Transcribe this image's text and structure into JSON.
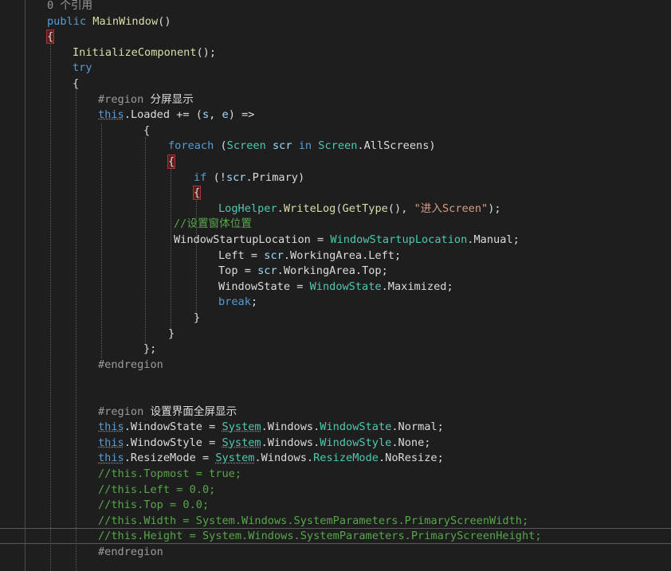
{
  "editor": {
    "codelens": "0 个引用",
    "lines": [
      [
        [
          "lens",
          "0 个引用"
        ]
      ],
      [
        [
          "kw",
          "public "
        ],
        [
          "method",
          "MainWindow"
        ],
        [
          "plain",
          "()"
        ]
      ],
      [
        [
          "hlbr",
          "{"
        ]
      ],
      [
        [
          "method",
          "InitializeComponent"
        ],
        [
          "plain",
          "();"
        ]
      ],
      [
        [
          "kw",
          "try"
        ]
      ],
      [
        [
          "plain",
          "{"
        ]
      ],
      [
        [
          "region",
          "#region "
        ],
        [
          "plain",
          "分屏显示"
        ]
      ],
      [
        [
          "kw",
          "this"
        ],
        [
          "plain",
          "."
        ],
        [
          "plain",
          "Loaded += ("
        ],
        [
          "param",
          "s"
        ],
        [
          "plain",
          ", "
        ],
        [
          "param",
          "e"
        ],
        [
          "plain",
          ") =>"
        ]
      ],
      [
        [
          "plain",
          "{"
        ]
      ],
      [
        [
          "kw",
          "foreach "
        ],
        [
          "plain",
          "("
        ],
        [
          "type",
          "Screen "
        ],
        [
          "param",
          "scr "
        ],
        [
          "kw",
          "in "
        ],
        [
          "type",
          "Screen"
        ],
        [
          "plain",
          ".AllScreens)"
        ]
      ],
      [
        [
          "hlbr",
          "{"
        ]
      ],
      [
        [
          "kw",
          "if "
        ],
        [
          "plain",
          "(!"
        ],
        [
          "param",
          "scr"
        ],
        [
          "plain",
          ".Primary)"
        ]
      ],
      [
        [
          "hlbr",
          "{"
        ]
      ],
      [
        [
          "type",
          "LogHelper"
        ],
        [
          "plain",
          "."
        ],
        [
          "method",
          "WriteLog"
        ],
        [
          "plain",
          "("
        ],
        [
          "method",
          "GetType"
        ],
        [
          "plain",
          "(), "
        ],
        [
          "str",
          "\"进入Screen\""
        ],
        [
          "plain",
          ");"
        ]
      ],
      [
        [
          "comment",
          "//设置窗体位置"
        ]
      ],
      [
        [
          "plain",
          "WindowStartupLocation = "
        ],
        [
          "type",
          "WindowStartupLocation"
        ],
        [
          "plain",
          ".Manual;"
        ]
      ],
      [
        [
          "plain",
          "Left = "
        ],
        [
          "param",
          "scr"
        ],
        [
          "plain",
          ".WorkingArea.Left;"
        ]
      ],
      [
        [
          "plain",
          "Top = "
        ],
        [
          "param",
          "scr"
        ],
        [
          "plain",
          ".WorkingArea.Top;"
        ]
      ],
      [
        [
          "plain",
          "WindowState = "
        ],
        [
          "type",
          "WindowState"
        ],
        [
          "plain",
          ".Maximized;"
        ]
      ],
      [
        [
          "kw",
          "break"
        ],
        [
          "plain",
          ";"
        ]
      ],
      [
        [
          "plain",
          "}"
        ]
      ],
      [
        [
          "plain",
          "}"
        ]
      ],
      [
        [
          "plain",
          "};"
        ]
      ],
      [
        [
          "region",
          "#endregion"
        ]
      ],
      [],
      [],
      [
        [
          "region",
          "#region "
        ],
        [
          "plain",
          "设置界面全屏显示"
        ]
      ],
      [
        [
          "kw",
          "this"
        ],
        [
          "plain",
          ".WindowState = "
        ],
        [
          "type",
          "System"
        ],
        [
          "plain",
          ".Windows."
        ],
        [
          "type",
          "WindowState"
        ],
        [
          "plain",
          ".Normal;"
        ]
      ],
      [
        [
          "kw",
          "this"
        ],
        [
          "plain",
          ".WindowStyle = "
        ],
        [
          "type",
          "System"
        ],
        [
          "plain",
          ".Windows."
        ],
        [
          "type",
          "WindowStyle"
        ],
        [
          "plain",
          ".None;"
        ]
      ],
      [
        [
          "kw",
          "this"
        ],
        [
          "plain",
          ".ResizeMode = "
        ],
        [
          "type",
          "System"
        ],
        [
          "plain",
          ".Windows."
        ],
        [
          "type",
          "ResizeMode"
        ],
        [
          "plain",
          ".NoResize;"
        ]
      ],
      [
        [
          "comment",
          "//this.Topmost = true;"
        ]
      ],
      [
        [
          "comment",
          "//this.Left = 0.0;"
        ]
      ],
      [
        [
          "comment",
          "//this.Top = 0.0;"
        ]
      ],
      [
        [
          "comment",
          "//this.Width = System.Windows.SystemParameters.PrimaryScreenWidth;"
        ]
      ],
      [
        [
          "comment",
          "//this.Height = System.Windows.SystemParameters.PrimaryScreenHeight;"
        ]
      ],
      [
        [
          "region",
          "#endregion"
        ]
      ]
    ],
    "colors": {
      "background": "#1e1e1e",
      "keyword": "#569cd6",
      "type": "#4ec9b0",
      "method": "#dcdcaa",
      "comment": "#57a64a",
      "string": "#d69d85",
      "brace_highlight": "#5a1d1d"
    }
  }
}
